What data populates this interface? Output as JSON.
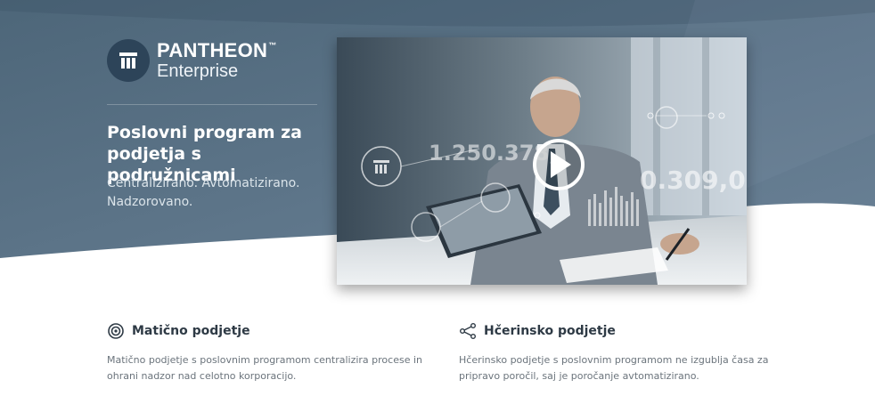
{
  "brand": {
    "name": "PANTHEON",
    "trademark": "™",
    "product": "Enterprise"
  },
  "hero": {
    "headline": "Poslovni program za podjetja s podružnicami",
    "tagline": "Centralizirano. Avtomatizirano. Nadzorovano."
  },
  "video": {
    "overlay_value_1": "1.250.378,",
    "overlay_value_2": "0.309,0"
  },
  "features": [
    {
      "icon": "target-icon",
      "title": "Matično podjetje",
      "description": "Matično podjetje s poslovnim programom centralizira procese in ohrani nadzor nad celotno korporacijo."
    },
    {
      "icon": "share-icon",
      "title": "Hčerinsko podjetje",
      "description": "Hčerinsko podjetje s poslovnim programom ne izgublja časa za pripravo poročil, saj je poročanje avtomatizirano."
    }
  ],
  "colors": {
    "hero": "#536b80",
    "hero_dark": "#2d4459",
    "text_dark": "#2e3a45",
    "text_muted": "#6b747c"
  }
}
